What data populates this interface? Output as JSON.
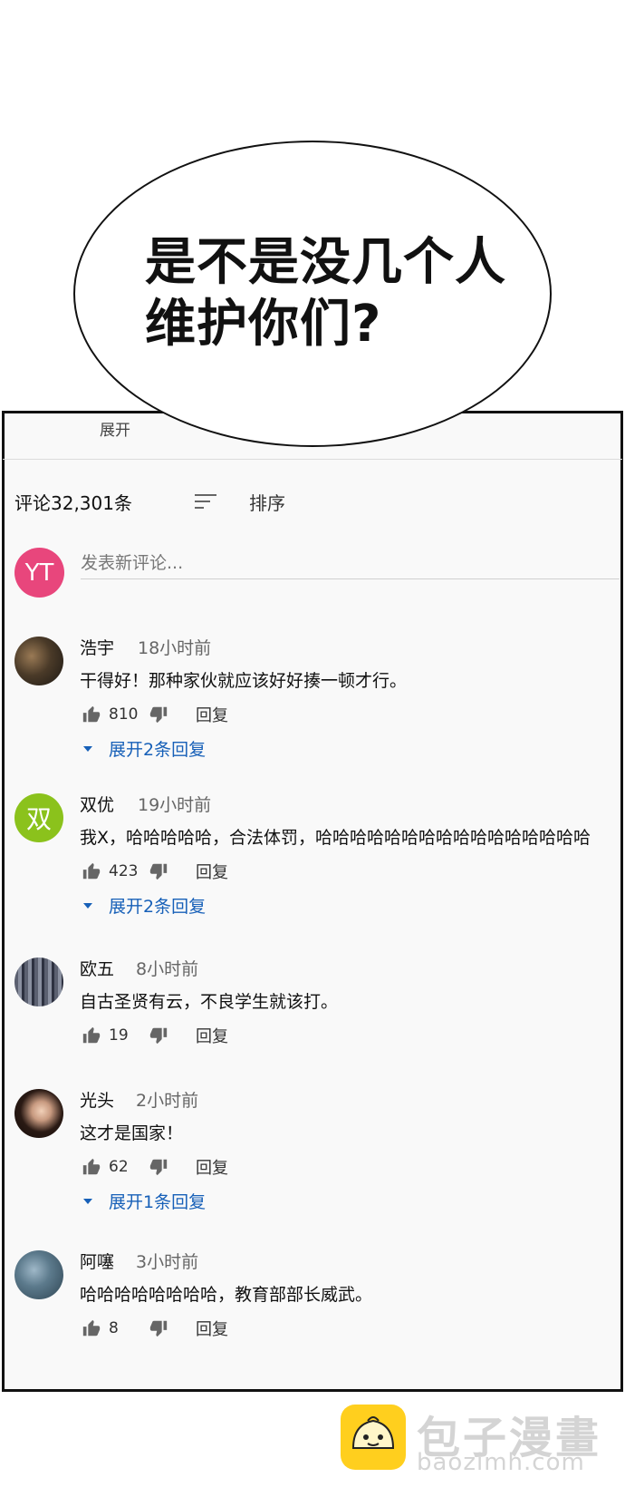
{
  "speech_bubble": {
    "line1": "是不是没几个人",
    "line2": "维护你们?"
  },
  "header": {
    "expand_label": "展开",
    "comment_count": "评论32,301条",
    "sort_label": "排序",
    "my_avatar_initials": "YT",
    "new_comment_placeholder": "发表新评论..."
  },
  "comments": [
    {
      "author": "浩宇",
      "time": "18小时前",
      "text": "干得好！那种家伙就应该好好揍一顿才行。",
      "likes": "810",
      "reply": "回复",
      "expand": "展开2条回复",
      "avatar": "photo"
    },
    {
      "author": "双优",
      "time": "19小时前",
      "text": "我X，哈哈哈哈哈，合法体罚，哈哈哈哈哈哈哈哈哈哈哈哈哈哈哈哈",
      "likes": "423",
      "reply": "回复",
      "expand": "展开2条回复",
      "avatar_letter": "双"
    },
    {
      "author": "欧五",
      "time": "8小时前",
      "text": "自古圣贤有云，不良学生就该打。",
      "likes": "19",
      "reply": "回复",
      "avatar": "photo"
    },
    {
      "author": "光头",
      "time": "2小时前",
      "text": "这才是国家！",
      "likes": "62",
      "reply": "回复",
      "expand": "展开1条回复",
      "avatar": "photo"
    },
    {
      "author": "阿噻",
      "time": "3小时前",
      "text": "哈哈哈哈哈哈哈哈，教育部部长威武。",
      "likes": "8",
      "reply": "回复",
      "avatar": "photo"
    }
  ],
  "watermark": {
    "name": "包子漫畫",
    "url": "baozimh.com"
  },
  "colors": {
    "accent_link": "#1760b8",
    "my_avatar": "#e8467c",
    "letter_avatar": "#8bc21c",
    "logo_yellow": "#ffcf1e"
  }
}
